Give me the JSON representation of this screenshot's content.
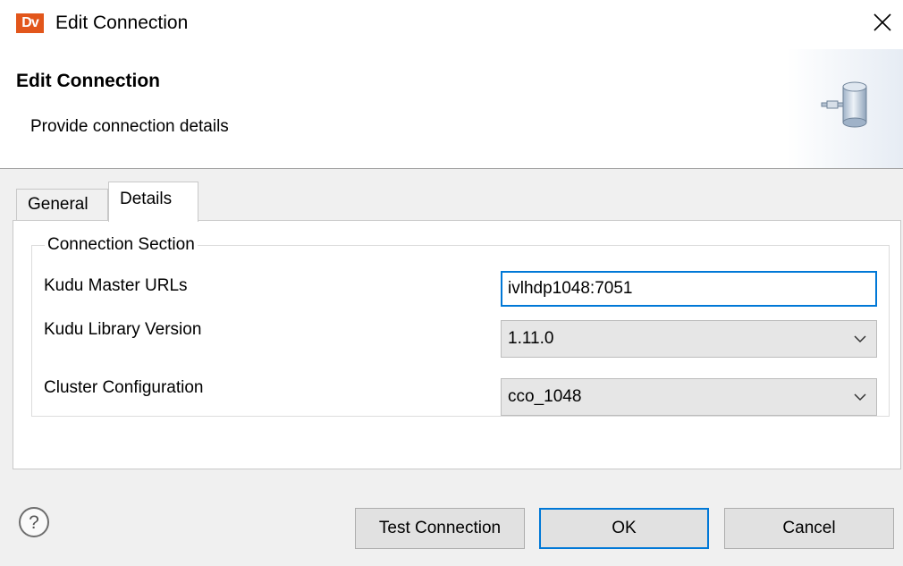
{
  "window": {
    "logo_text": "Dv",
    "logo_color": "#e2561b",
    "title": "Edit Connection",
    "close_icon": "close-icon"
  },
  "header": {
    "title": "Edit Connection",
    "subtitle": "Provide connection details",
    "icon": "database-connection-icon"
  },
  "tabs": [
    {
      "label": "General",
      "active": false
    },
    {
      "label": "Details",
      "active": true
    }
  ],
  "connection_section": {
    "legend": "Connection Section",
    "fields": {
      "master_urls": {
        "label": "Kudu Master URLs",
        "value": "ivlhdp1048:7051"
      },
      "library_version": {
        "label": "Kudu Library Version",
        "value": "1.11.0"
      },
      "cluster_config": {
        "label": "Cluster Configuration",
        "value": "cco_1048"
      }
    }
  },
  "footer": {
    "help_icon": "help-icon",
    "test_label": "Test Connection",
    "ok_label": "OK",
    "cancel_label": "Cancel"
  },
  "colors": {
    "accent": "#0078d7"
  }
}
